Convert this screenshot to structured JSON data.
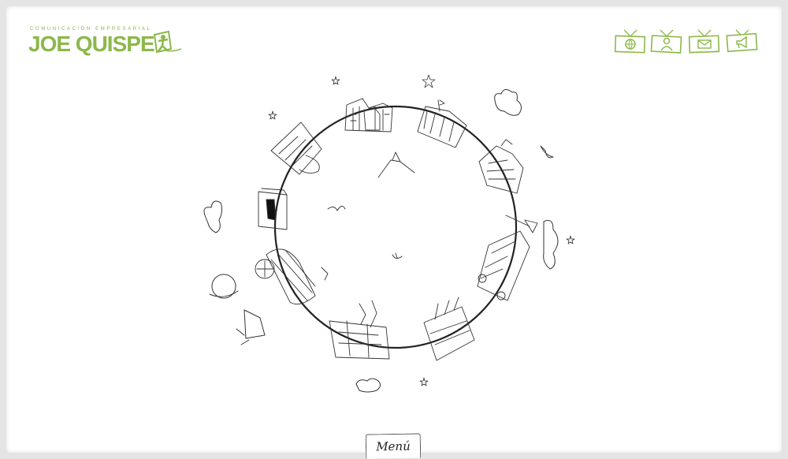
{
  "logo": {
    "tagline": "COMUNICACIÓN EMPRESARIAL",
    "name": "JOE QUISPE",
    "color": "#8cb84a"
  },
  "nav": {
    "items": [
      {
        "icon": "globe-icon"
      },
      {
        "icon": "person-icon"
      },
      {
        "icon": "mail-icon"
      },
      {
        "icon": "megaphone-icon"
      }
    ]
  },
  "menu": {
    "label": "Menú"
  }
}
